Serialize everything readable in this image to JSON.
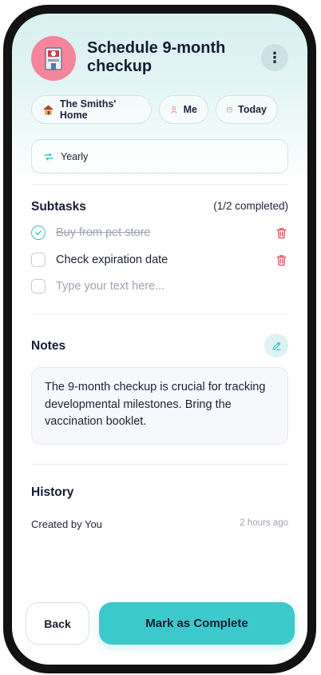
{
  "task": {
    "title": "Schedule 9-month checkup",
    "icon": "medical-kit-icon"
  },
  "chips": {
    "home": "The Smiths' Home",
    "assignee": "Me",
    "date": "Today"
  },
  "recurrence": {
    "label": "Yearly"
  },
  "subtasks": {
    "title": "Subtasks",
    "progress": "(1/2 completed)",
    "items": [
      {
        "label": "Buy from pet store",
        "done": true
      },
      {
        "label": "Check expiration date",
        "done": false
      }
    ],
    "new_placeholder": "Type your text here..."
  },
  "notes": {
    "title": "Notes",
    "text": "The 9-month checkup is crucial for tracking developmental milestones. Bring the vaccination booklet."
  },
  "history": {
    "title": "History",
    "entry": "Created by You",
    "time": "2 hours ago"
  },
  "actions": {
    "back": "Back",
    "complete": "Mark as Complete"
  },
  "colors": {
    "accent": "#3cc9cb",
    "avatar": "#f4859a",
    "delete": "#d9534f"
  }
}
